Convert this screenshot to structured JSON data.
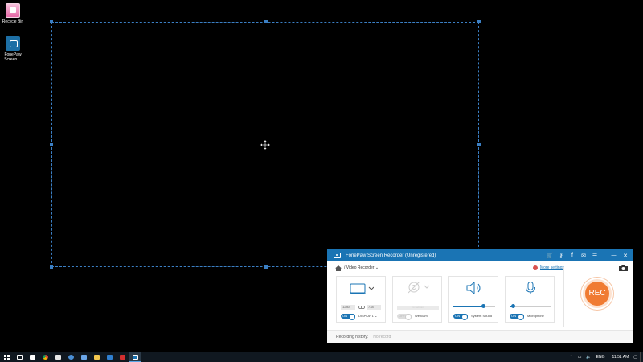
{
  "desktop": {
    "icons": [
      {
        "label": "Recycle Bin"
      },
      {
        "label": "FonePaw Screen ..."
      }
    ]
  },
  "recorder": {
    "title": "FonePaw Screen Recorder (Unregistered)",
    "mode": "Video Recorder",
    "more_settings": "More settings",
    "display": {
      "width": "1280",
      "height": "738",
      "toggle": "ON",
      "label": "DISPLAY1"
    },
    "webcam": {
      "toggle": "OFF",
      "label": "Webcam",
      "select": "no webcam"
    },
    "system_sound": {
      "toggle": "ON",
      "label": "System Sound",
      "level": 0.72
    },
    "microphone": {
      "toggle": "ON",
      "label": "Microphone",
      "level": 0.08
    },
    "rec_label": "REC",
    "history_label": "Recording history:",
    "history_value": "No record"
  },
  "taskbar": {
    "language": "ENG",
    "time": "11:51 AM"
  },
  "colors": {
    "accent": "#1a74b4",
    "rec": "#f07b32",
    "selection": "#3b7fc4"
  }
}
